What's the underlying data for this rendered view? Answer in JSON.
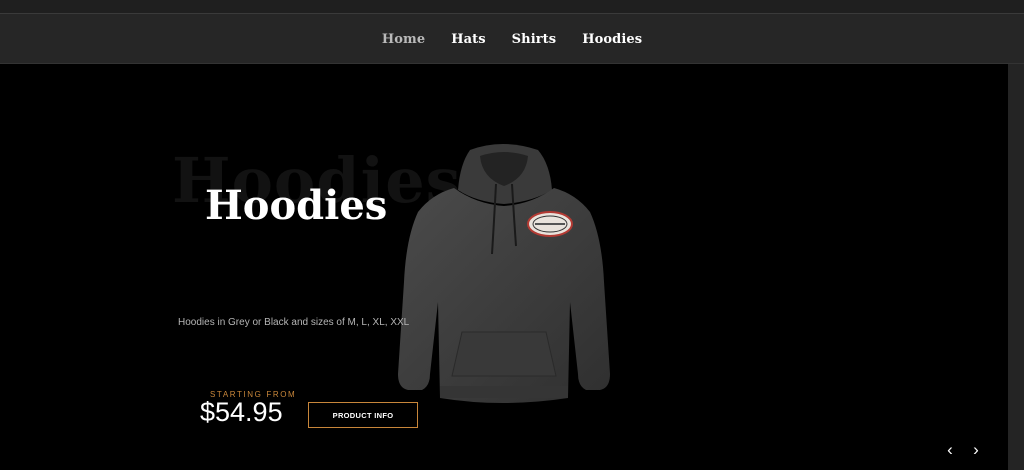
{
  "nav": {
    "items": [
      {
        "label": "Home",
        "active": true
      },
      {
        "label": "Hats"
      },
      {
        "label": "Shirts"
      },
      {
        "label": "Hoodies"
      }
    ]
  },
  "hero": {
    "background_title": "Hoodies",
    "title": "Hoodies",
    "description": "Hoodies in Grey or Black and sizes of M, L, XL, XXL",
    "starting_label": "STARTING FROM",
    "price": "$54.95",
    "button_label": "PRODUCT INFO",
    "image": "hoodie-image",
    "colors": {
      "accent": "#c8863a",
      "background": "#000000",
      "nav": "#262626"
    }
  },
  "carousel": {
    "prev_icon": "chevron-left-icon",
    "next_icon": "chevron-right-icon"
  }
}
